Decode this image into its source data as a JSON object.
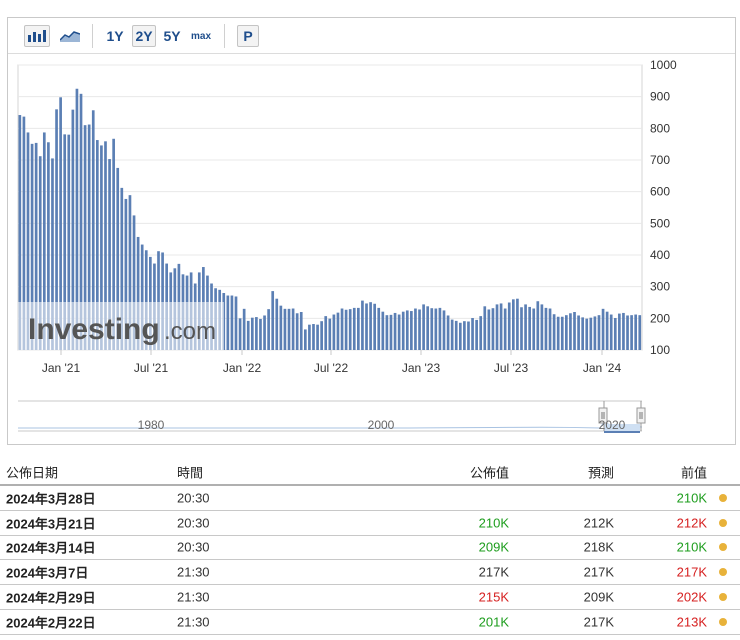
{
  "toolbar": {
    "bar_chart_icon": "bar-chart-icon",
    "line_chart_icon": "area-chart-icon",
    "ranges": [
      "1Y",
      "2Y",
      "5Y",
      "max"
    ],
    "active_range": "2Y",
    "p_label": "P"
  },
  "watermark": {
    "brand": "Investing",
    "suffix": ".com"
  },
  "navigator": {
    "ticks": [
      "1980",
      "2000",
      "2020"
    ]
  },
  "chart_data": {
    "type": "bar",
    "color": "#5b7fb4",
    "x_labels": [
      "Jan '21",
      "Jul '21",
      "Jan '22",
      "Jul '22",
      "Jan '23",
      "Jul '23",
      "Jan '24"
    ],
    "y_ticks": [
      100,
      200,
      300,
      400,
      500,
      600,
      700,
      800,
      900,
      1000
    ],
    "ylim": [
      100,
      1000
    ],
    "grid": true,
    "values": [
      842,
      837,
      787,
      751,
      754,
      712,
      787,
      756,
      705,
      860,
      898,
      781,
      780,
      859,
      925,
      909,
      810,
      812,
      857,
      763,
      746,
      759,
      703,
      767,
      675,
      612,
      577,
      589,
      525,
      457,
      433,
      415,
      394,
      373,
      412,
      408,
      373,
      345,
      358,
      372,
      339,
      335,
      345,
      310,
      345,
      362,
      335,
      310,
      295,
      290,
      280,
      272,
      272,
      269,
      200,
      230,
      192,
      202,
      204,
      198,
      209,
      229,
      286,
      262,
      240,
      230,
      230,
      231,
      216,
      220,
      165,
      180,
      182,
      180,
      191,
      207,
      199,
      212,
      218,
      231,
      227,
      229,
      233,
      233,
      256,
      247,
      251,
      246,
      233,
      221,
      210,
      211,
      217,
      212,
      221,
      225,
      223,
      231,
      228,
      244,
      238,
      232,
      231,
      233,
      225,
      209,
      196,
      192,
      186,
      191,
      190,
      201,
      195,
      207,
      238,
      228,
      232,
      244,
      247,
      231,
      250,
      260,
      262,
      235,
      244,
      236,
      231,
      254,
      244,
      233,
      231,
      213,
      205,
      205,
      210,
      216,
      220,
      209,
      203,
      199,
      202,
      206,
      210,
      230,
      221,
      212,
      201,
      215,
      217,
      209,
      210,
      212,
      210
    ]
  },
  "table": {
    "headers": {
      "date": "公佈日期",
      "time": "時間",
      "actual": "公佈值",
      "forecast": "預測",
      "previous": "前值"
    },
    "rows": [
      {
        "date": "2024年3月28日",
        "time": "20:30",
        "actual": "",
        "forecast": "",
        "previous": "210K",
        "actual_color": "black",
        "previous_color": "green"
      },
      {
        "date": "2024年3月21日",
        "time": "20:30",
        "actual": "210K",
        "forecast": "212K",
        "previous": "212K",
        "actual_color": "green",
        "previous_color": "red"
      },
      {
        "date": "2024年3月14日",
        "time": "20:30",
        "actual": "209K",
        "forecast": "218K",
        "previous": "210K",
        "actual_color": "green",
        "previous_color": "green"
      },
      {
        "date": "2024年3月7日",
        "time": "21:30",
        "actual": "217K",
        "forecast": "217K",
        "previous": "217K",
        "actual_color": "black",
        "previous_color": "red"
      },
      {
        "date": "2024年2月29日",
        "time": "21:30",
        "actual": "215K",
        "forecast": "209K",
        "previous": "202K",
        "actual_color": "red",
        "previous_color": "red"
      },
      {
        "date": "2024年2月22日",
        "time": "21:30",
        "actual": "201K",
        "forecast": "217K",
        "previous": "213K",
        "actual_color": "green",
        "previous_color": "red"
      }
    ]
  }
}
